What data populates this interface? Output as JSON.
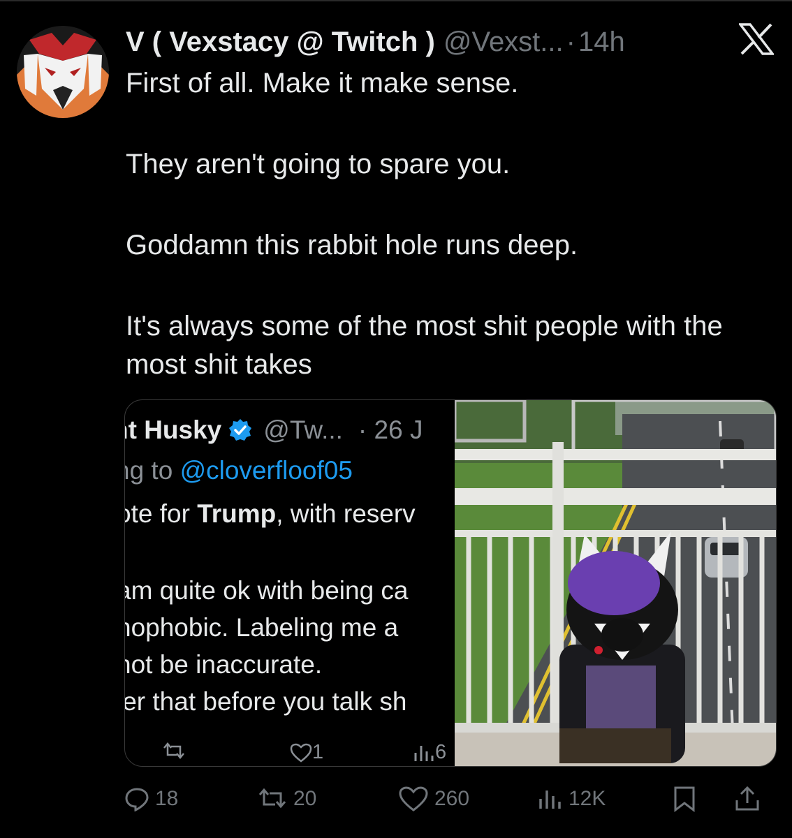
{
  "tweet": {
    "display_name": "V ( Vexstacy @ Twitch )",
    "handle": "@Vexst...",
    "separator": "·",
    "time": "14h",
    "lines": [
      "First of all. Make it make sense.",
      "They aren't going to spare you.",
      "Goddamn this rabbit hole runs deep.",
      "It's always some of the most shit people with the most shit takes"
    ]
  },
  "quoted": {
    "name": "nt Husky",
    "handle": "@Tw...",
    "date": "· 26 J",
    "reply_prefix": "ng to",
    "reply_mention": "@cloverfloof05",
    "line1_a": "ote for ",
    "line1_bold": "Trump",
    "line1_b": ", with reserv",
    "line2": "am quite ok with being ca",
    "line3": "nophobic. Labeling me a",
    "line4": "not be inaccurate.",
    "line5": "ler that before you talk sh",
    "likes": "1",
    "views": "6"
  },
  "actions": {
    "replies": "18",
    "reposts": "20",
    "likes": "260",
    "views": "12K"
  },
  "icons": [
    "avatar",
    "x-logo-icon",
    "verified-badge-icon",
    "reply-icon",
    "repost-icon",
    "like-icon",
    "views-icon",
    "bookmark-icon",
    "share-icon"
  ]
}
